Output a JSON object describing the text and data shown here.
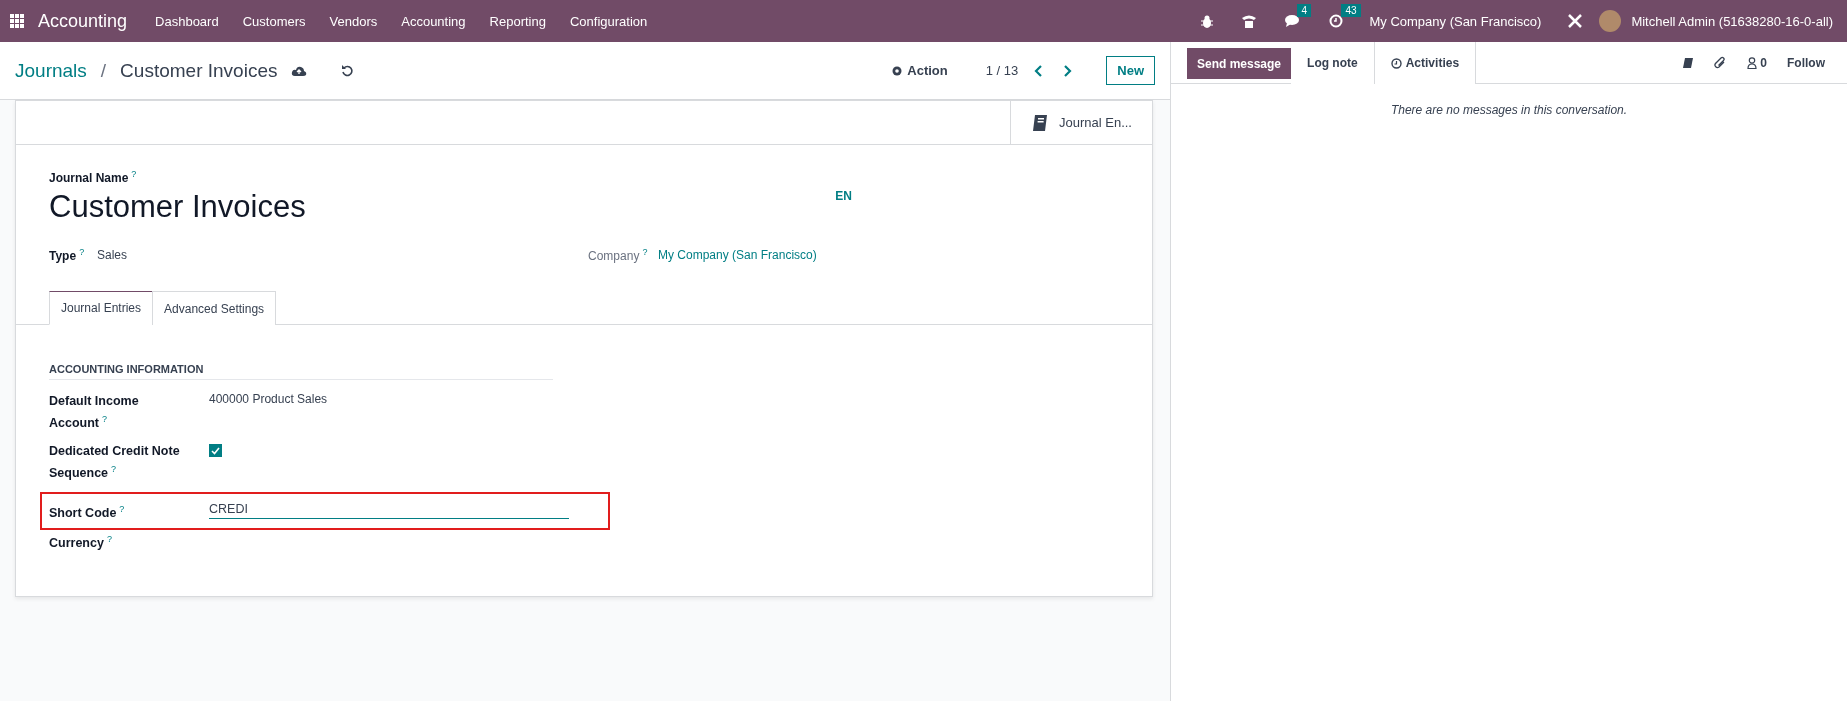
{
  "navbar": {
    "app_name": "Accounting",
    "menu": [
      "Dashboard",
      "Customers",
      "Vendors",
      "Accounting",
      "Reporting",
      "Configuration"
    ],
    "messages_count": "4",
    "activities_count": "43",
    "company": "My Company (San Francisco)",
    "user": "Mitchell Admin (51638280-16-0-all)"
  },
  "control_panel": {
    "breadcrumb_parent": "Journals",
    "breadcrumb_separator": "/",
    "breadcrumb_current": "Customer Invoices",
    "action": "Action",
    "pager": "1 / 13",
    "new_button": "New"
  },
  "form": {
    "smart_button": "Journal En...",
    "name_label": "Journal Name",
    "name_help": "?",
    "name": "Customer Invoices",
    "language": "EN",
    "type_label": "Type",
    "type_help": "?",
    "type_value": "Sales",
    "company_label": "Company",
    "company_help": "?",
    "company_value": "My Company (San Francisco)",
    "tabs": [
      {
        "label": "Journal Entries",
        "selected": true
      },
      {
        "label": "Advanced Settings",
        "selected": false
      }
    ],
    "section_title": "ACCOUNTING INFORMATION",
    "fields": [
      {
        "kind": "text",
        "label": "Default Income Account",
        "help": "?",
        "value": "400000 Product Sales",
        "highlighted": false
      },
      {
        "kind": "checkbox",
        "label": "Dedicated Credit Note Sequence",
        "help": "?",
        "checked": true,
        "highlighted": false
      },
      {
        "kind": "input",
        "label": "Short Code",
        "help": "?",
        "value": "CREDI",
        "highlighted": true
      },
      {
        "kind": "text",
        "label": "Currency",
        "help": "?",
        "highlighted": false
      }
    ]
  },
  "chatter": {
    "send_message": "Send message",
    "log_note": "Log note",
    "activities": "Activities",
    "followers_count": "0",
    "follow": "Follow",
    "empty_message": "There are no messages in this conversation."
  }
}
